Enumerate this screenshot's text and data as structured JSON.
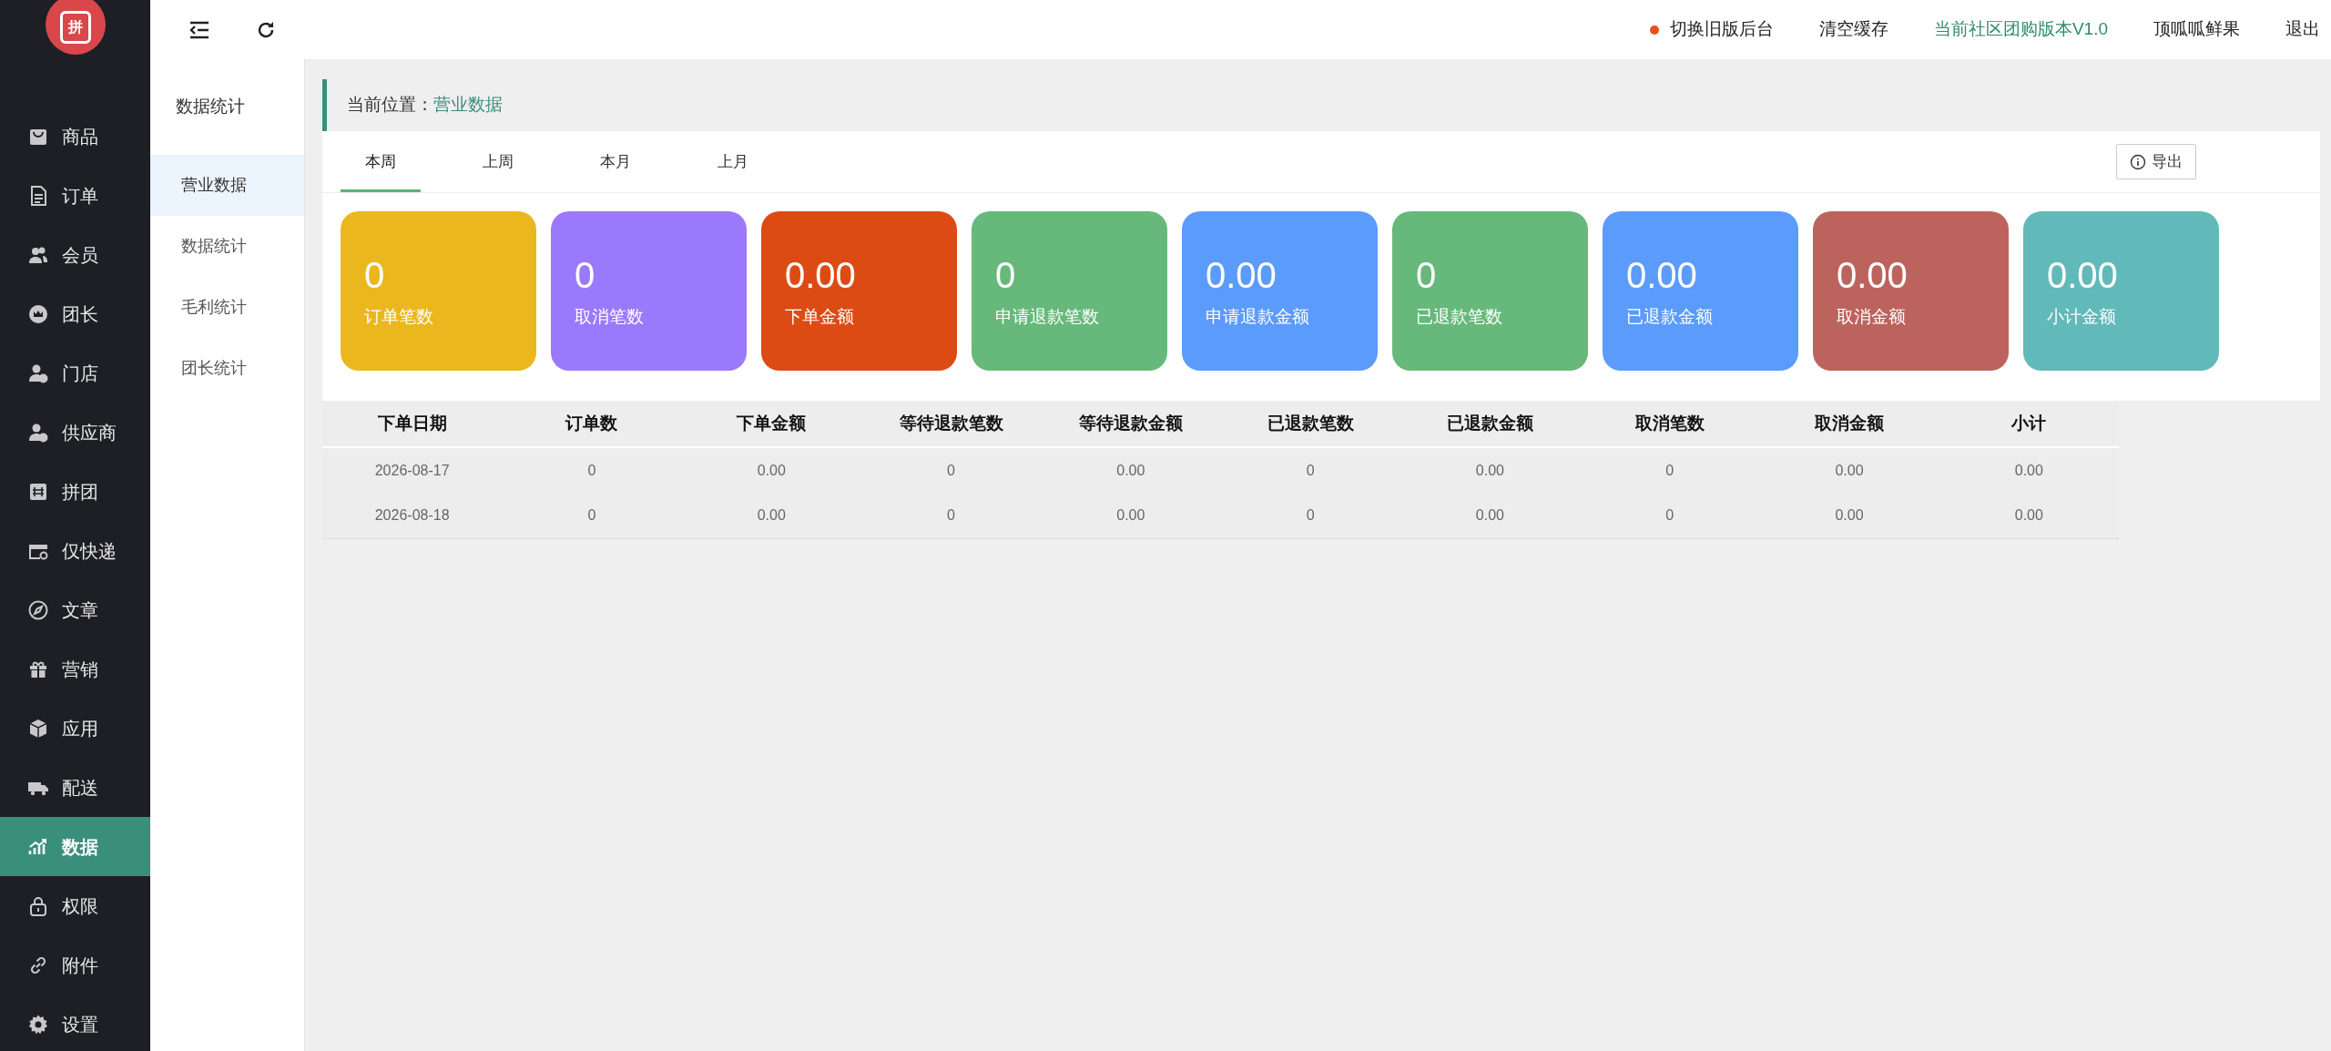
{
  "logo": {
    "text": "拼"
  },
  "sidebar": {
    "items": [
      {
        "label": "商品",
        "kind": "bag",
        "selected": false
      },
      {
        "label": "订单",
        "kind": "document",
        "selected": false
      },
      {
        "label": "会员",
        "kind": "users",
        "selected": false
      },
      {
        "label": "团长",
        "kind": "crown",
        "selected": false
      },
      {
        "label": "门店",
        "kind": "userbadge",
        "selected": false
      },
      {
        "label": "供应商",
        "kind": "userbadge",
        "selected": false
      },
      {
        "label": "拼团",
        "kind": "square",
        "selected": false
      },
      {
        "label": "仅快递",
        "kind": "store",
        "selected": false
      },
      {
        "label": "文章",
        "kind": "compass",
        "selected": false
      },
      {
        "label": "营销",
        "kind": "gift",
        "selected": false
      },
      {
        "label": "应用",
        "kind": "box",
        "selected": false
      },
      {
        "label": "配送",
        "kind": "truck",
        "selected": false
      },
      {
        "label": "数据",
        "kind": "chart",
        "selected": true
      },
      {
        "label": "权限",
        "kind": "lock",
        "selected": false
      },
      {
        "label": "附件",
        "kind": "link",
        "selected": false
      },
      {
        "label": "设置",
        "kind": "gear",
        "selected": false
      }
    ]
  },
  "submenu": {
    "title": "数据统计",
    "items": [
      {
        "label": "营业数据",
        "selected": true
      },
      {
        "label": "数据统计",
        "selected": false
      },
      {
        "label": "毛利统计",
        "selected": false
      },
      {
        "label": "团长统计",
        "selected": false
      }
    ]
  },
  "topbar": {
    "links": [
      {
        "label": "切换旧版后台",
        "kind": "dot"
      },
      {
        "label": "清空缓存",
        "kind": "plain"
      },
      {
        "label": "当前社区团购版本V1.0",
        "kind": "accent"
      },
      {
        "label": "顶呱呱鲜果",
        "kind": "plain"
      },
      {
        "label": "退出",
        "kind": "plain"
      }
    ]
  },
  "breadcrumb": {
    "label": "当前位置：",
    "current": "营业数据"
  },
  "tabs": [
    {
      "label": "本周",
      "selected": true
    },
    {
      "label": "上周",
      "selected": false
    },
    {
      "label": "本月",
      "selected": false
    },
    {
      "label": "上月",
      "selected": false
    }
  ],
  "export_button": "导出",
  "cards": [
    {
      "value": "0",
      "label": "订单笔数",
      "color": "#ebb71e"
    },
    {
      "value": "0",
      "label": "取消笔数",
      "color": "#9b79fc"
    },
    {
      "value": "0.00",
      "label": "下单金额",
      "color": "#dd4b14"
    },
    {
      "value": "0",
      "label": "申请退款笔数",
      "color": "#66b97a"
    },
    {
      "value": "0.00",
      "label": "申请退款金额",
      "color": "#5b9bfc"
    },
    {
      "value": "0",
      "label": "已退款笔数",
      "color": "#66b97a"
    },
    {
      "value": "0.00",
      "label": "已退款金额",
      "color": "#5b9bfc"
    },
    {
      "value": "0.00",
      "label": "取消金额",
      "color": "#bc635d"
    },
    {
      "value": "0.00",
      "label": "小计金额",
      "color": "#62b9b9"
    }
  ],
  "table": {
    "columns": [
      "下单日期",
      "订单数",
      "下单金额",
      "等待退款笔数",
      "等待退款金额",
      "已退款笔数",
      "已退款金额",
      "取消笔数",
      "取消金额",
      "小计"
    ],
    "rows": [
      [
        "2026-08-17",
        "0",
        "0.00",
        "0",
        "0.00",
        "0",
        "0.00",
        "0",
        "0.00",
        "0.00"
      ],
      [
        "2026-08-18",
        "0",
        "0.00",
        "0",
        "0.00",
        "0",
        "0.00",
        "0",
        "0.00",
        "0.00"
      ]
    ]
  }
}
